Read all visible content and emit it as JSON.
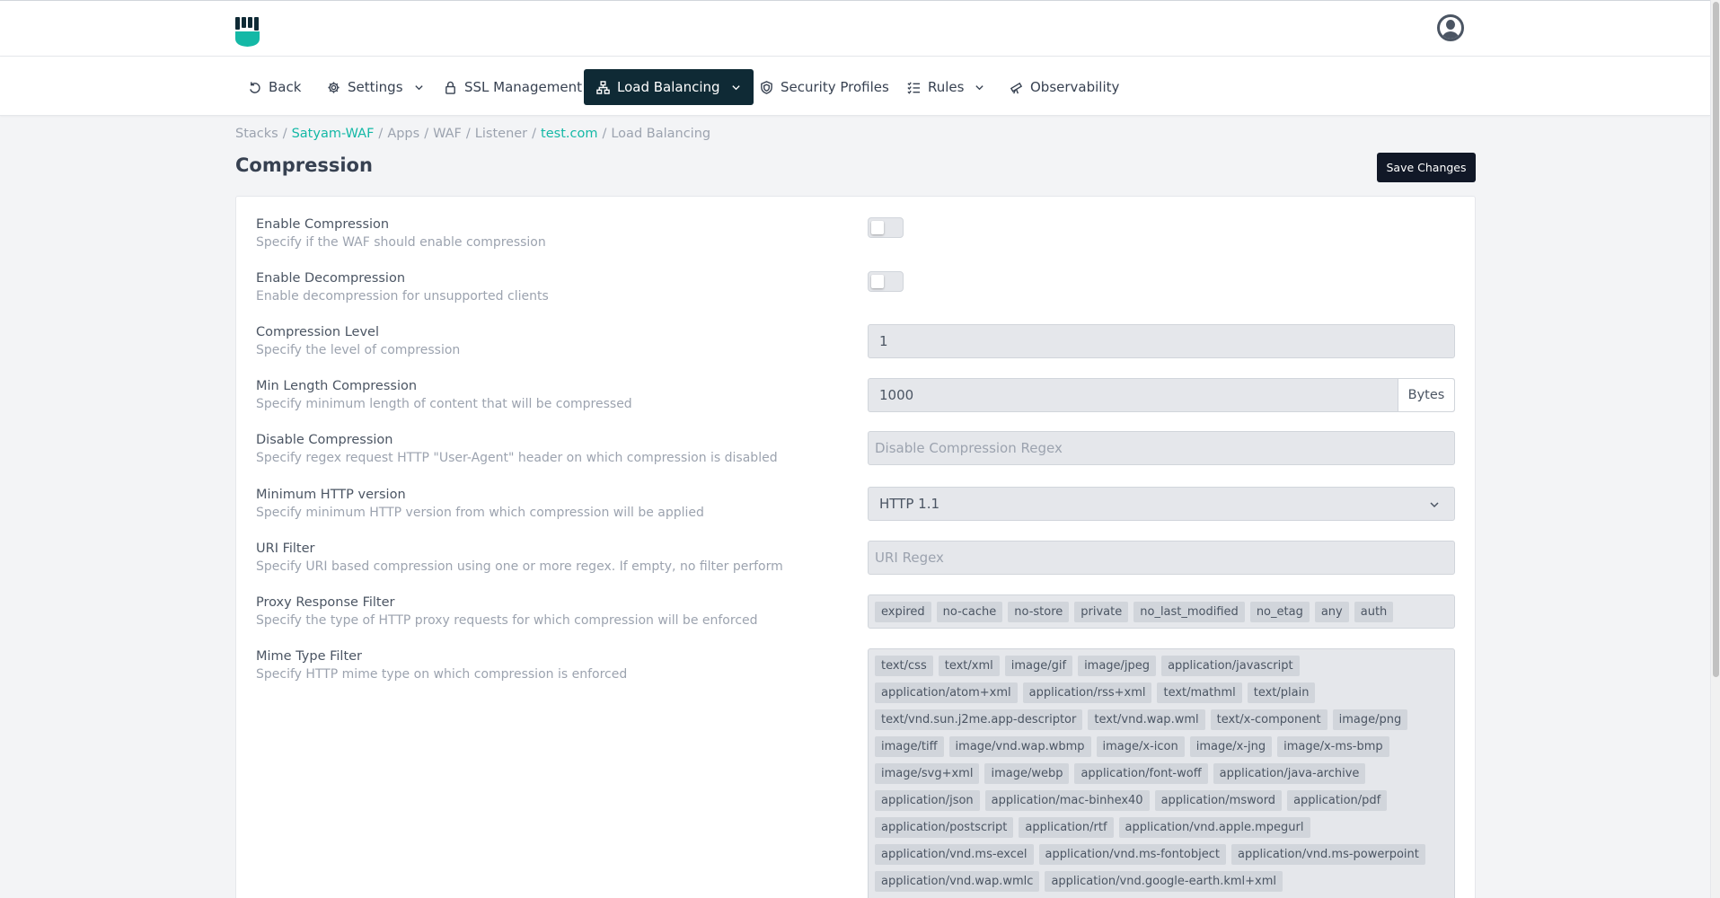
{
  "nav": {
    "items": [
      {
        "label": "Back",
        "icon": "undo-icon"
      },
      {
        "label": "Settings",
        "icon": "gear-icon"
      },
      {
        "label": "SSL Management",
        "icon": "lock-icon"
      },
      {
        "label": "Load Balancing",
        "icon": "network-icon"
      },
      {
        "label": "Security Profiles",
        "icon": "shield-icon"
      },
      {
        "label": "Rules",
        "icon": "list-check-icon"
      },
      {
        "label": "Observability",
        "icon": "telescope-icon"
      }
    ]
  },
  "breadcrumb": [
    "Stacks",
    "Satyam-WAF",
    "Apps",
    "WAF",
    "Listener",
    "test.com",
    "Load Balancing"
  ],
  "page": {
    "title": "Compression",
    "save_label": "Save Changes"
  },
  "form": {
    "enable_compression": {
      "label": "Enable Compression",
      "desc": "Specify if the WAF should enable compression"
    },
    "enable_decompression": {
      "label": "Enable Decompression",
      "desc": "Enable decompression for unsupported clients"
    },
    "compression_level": {
      "label": "Compression Level",
      "desc": "Specify the level of compression",
      "value": "1"
    },
    "min_length": {
      "label": "Min Length Compression",
      "desc": "Specify minimum length of content that will be compressed",
      "value": "1000",
      "unit": "Bytes"
    },
    "disable_compression": {
      "label": "Disable Compression",
      "desc": "Specify regex request HTTP \"User-Agent\" header on which compression is disabled",
      "placeholder": "Disable Compression Regex"
    },
    "min_http_version": {
      "label": "Minimum HTTP version",
      "desc": "Specify minimum HTTP version from which compression will be applied",
      "value": "HTTP 1.1"
    },
    "uri_filter": {
      "label": "URI Filter",
      "desc": "Specify URI based compression using one or more regex. If empty, no filter perform",
      "placeholder": "URI Regex"
    },
    "proxy_filter": {
      "label": "Proxy Response Filter",
      "desc": "Specify the type of HTTP proxy requests for which compression will be enforced",
      "tags": [
        "expired",
        "no-cache",
        "no-store",
        "private",
        "no_last_modified",
        "no_etag",
        "any",
        "auth"
      ]
    },
    "mime_filter": {
      "label": "Mime Type Filter",
      "desc": "Specify HTTP mime type on which compression is enforced",
      "tags": [
        "text/css",
        "text/xml",
        "image/gif",
        "image/jpeg",
        "application/javascript",
        "application/atom+xml",
        "application/rss+xml",
        "text/mathml",
        "text/plain",
        "text/vnd.sun.j2me.app-descriptor",
        "text/vnd.wap.wml",
        "text/x-component",
        "image/png",
        "image/tiff",
        "image/vnd.wap.wbmp",
        "image/x-icon",
        "image/x-jng",
        "image/x-ms-bmp",
        "image/svg+xml",
        "image/webp",
        "application/font-woff",
        "application/java-archive",
        "application/json",
        "application/mac-binhex40",
        "application/msword",
        "application/pdf",
        "application/postscript",
        "application/rtf",
        "application/vnd.apple.mpegurl",
        "application/vnd.ms-excel",
        "application/vnd.ms-fontobject",
        "application/vnd.ms-powerpoint",
        "application/vnd.wap.wmlc",
        "application/vnd.google-earth.kml+xml"
      ]
    }
  },
  "colors": {
    "accent": "#14b8a6",
    "active_nav": "#0f2a35",
    "logo": "#14b8a6"
  }
}
